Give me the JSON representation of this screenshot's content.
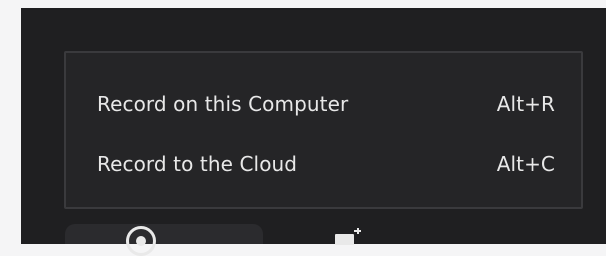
{
  "record_menu": {
    "items": [
      {
        "label": "Record on this Computer",
        "shortcut": "Alt+R"
      },
      {
        "label": "Record to the Cloud",
        "shortcut": "Alt+C"
      }
    ]
  },
  "toolbar": {
    "icons": [
      "record-icon",
      "share-screen-icon"
    ]
  },
  "colors": {
    "page_background": "#f5f5f6",
    "app_background": "#1f1f21",
    "menu_background": "#252527",
    "menu_border": "#3a3a3d",
    "text": "#e8e8e8"
  }
}
